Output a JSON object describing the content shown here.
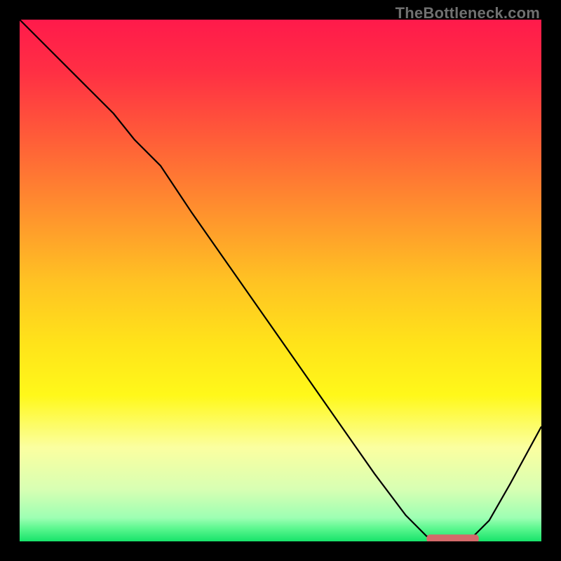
{
  "watermark": "TheBottleneck.com",
  "colors": {
    "frame": "#000000",
    "gradient_stops": [
      {
        "offset": 0.0,
        "color": "#ff1a4b"
      },
      {
        "offset": 0.1,
        "color": "#ff2f44"
      },
      {
        "offset": 0.22,
        "color": "#ff5a39"
      },
      {
        "offset": 0.35,
        "color": "#ff8a2f"
      },
      {
        "offset": 0.5,
        "color": "#ffc223"
      },
      {
        "offset": 0.62,
        "color": "#ffe31a"
      },
      {
        "offset": 0.72,
        "color": "#fff81a"
      },
      {
        "offset": 0.82,
        "color": "#fbffa0"
      },
      {
        "offset": 0.9,
        "color": "#d8ffb3"
      },
      {
        "offset": 0.955,
        "color": "#9dffb3"
      },
      {
        "offset": 0.975,
        "color": "#5cf78f"
      },
      {
        "offset": 1.0,
        "color": "#17e36a"
      }
    ],
    "curve": "#000000",
    "marker": "#d46a6a"
  },
  "chart_data": {
    "type": "line",
    "title": "",
    "xlabel": "",
    "ylabel": "",
    "xlim": [
      0,
      100
    ],
    "ylim": [
      0,
      100
    ],
    "series": [
      {
        "name": "bottleneck-curve",
        "x": [
          0,
          6,
          12,
          18,
          22,
          27,
          33,
          40,
          47,
          54,
          61,
          68,
          74,
          78,
          82,
          86,
          90,
          94,
          100
        ],
        "y": [
          100,
          94,
          88,
          82,
          77,
          72,
          63,
          53,
          43,
          33,
          23,
          13,
          5,
          1,
          0,
          0,
          4,
          11,
          22
        ]
      }
    ],
    "marker": {
      "name": "optimal-range",
      "x_start": 78,
      "x_end": 88,
      "y": 0.5
    }
  }
}
